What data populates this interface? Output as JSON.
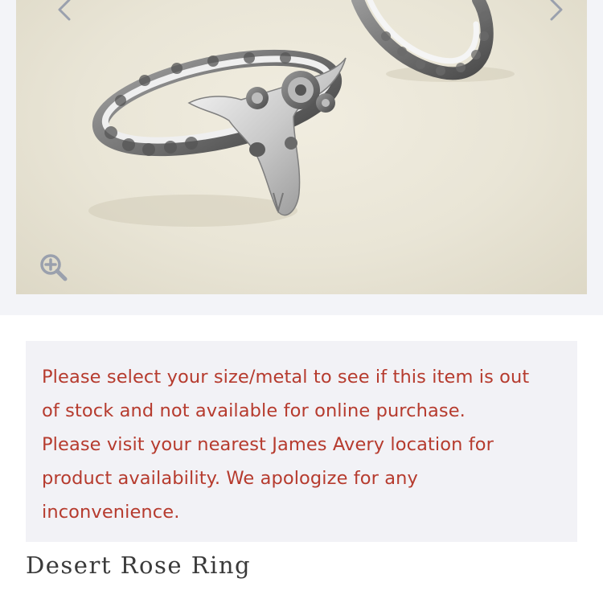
{
  "gallery": {
    "image_alt": "Desert Rose Ring",
    "prev_icon": "chevron-left-icon",
    "next_icon": "chevron-right-icon",
    "zoom_icon": "zoom-in-icon"
  },
  "notice": {
    "line1": "Please select your size/metal to see if this item is out",
    "line2": "of stock and not available for online purchase.",
    "line3": "Please visit your nearest James Avery location for",
    "line4": "product availability. We apologize for any",
    "line5": "inconvenience.",
    "color": "#b63b2e"
  },
  "product": {
    "title": "Desert Rose Ring"
  }
}
